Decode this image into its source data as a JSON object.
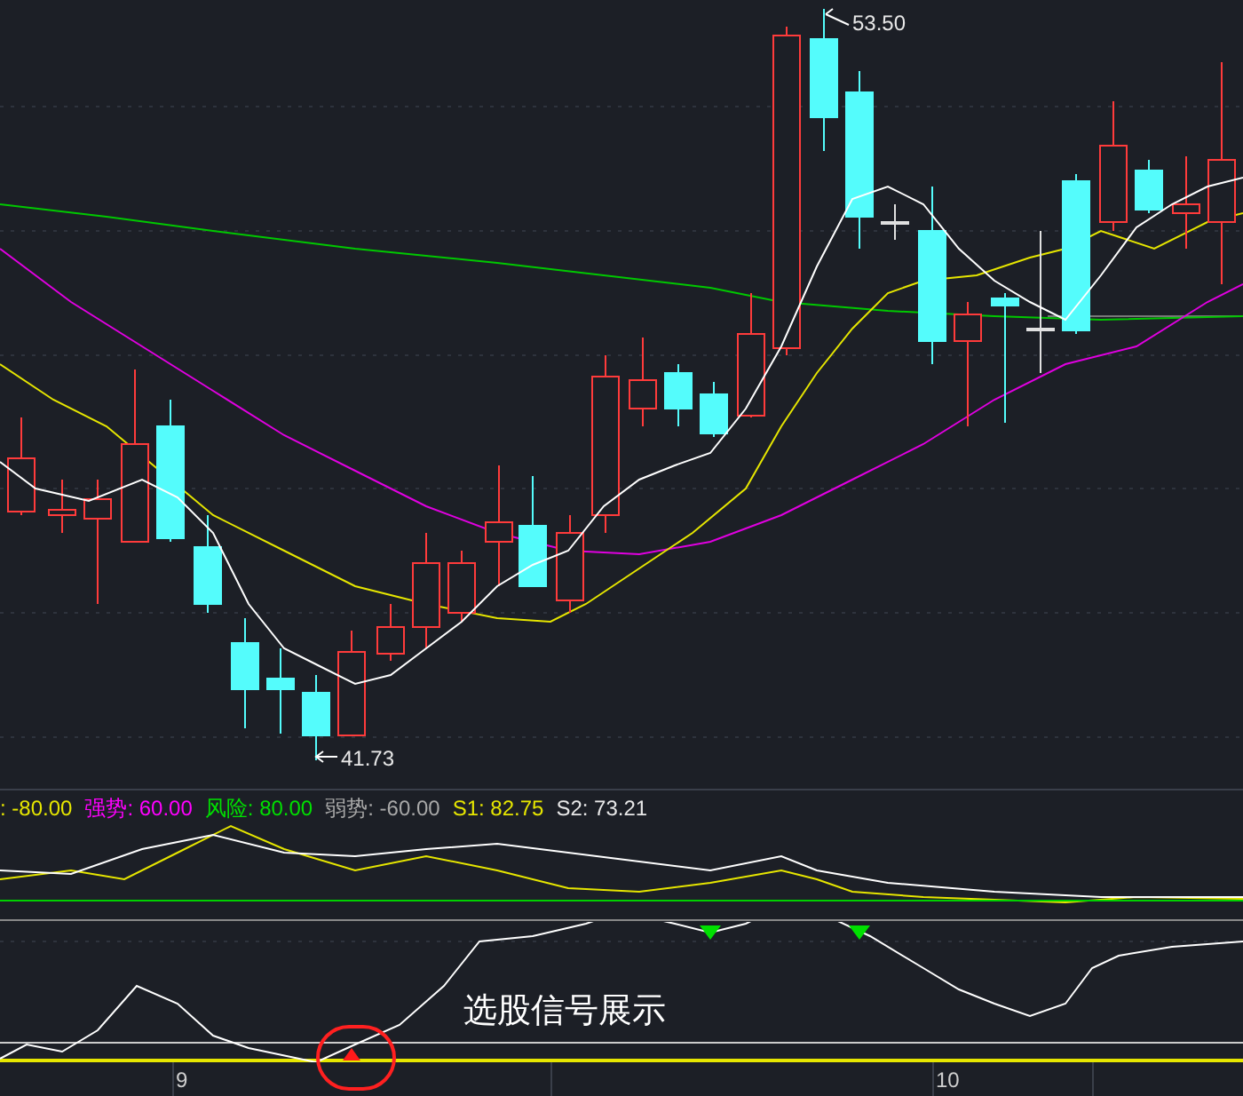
{
  "price_labels": {
    "high": "53.50",
    "low": "41.73"
  },
  "indicator_legend": [
    {
      "text": ": -80.00",
      "color": "#e6e600"
    },
    {
      "text": "强势: 60.00",
      "color": "#ff00ff"
    },
    {
      "text": "风险: 80.00",
      "color": "#00e000"
    },
    {
      "text": "弱势: -60.00",
      "color": "#a8a8a8"
    },
    {
      "text": "S1: 82.75",
      "color": "#e6e600"
    },
    {
      "text": "S2: 73.21",
      "color": "#e8e8e8"
    }
  ],
  "signal_panel": {
    "annotation": "选股信号展示"
  },
  "x_axis": {
    "labels": [
      "9",
      "10"
    ]
  }
}
